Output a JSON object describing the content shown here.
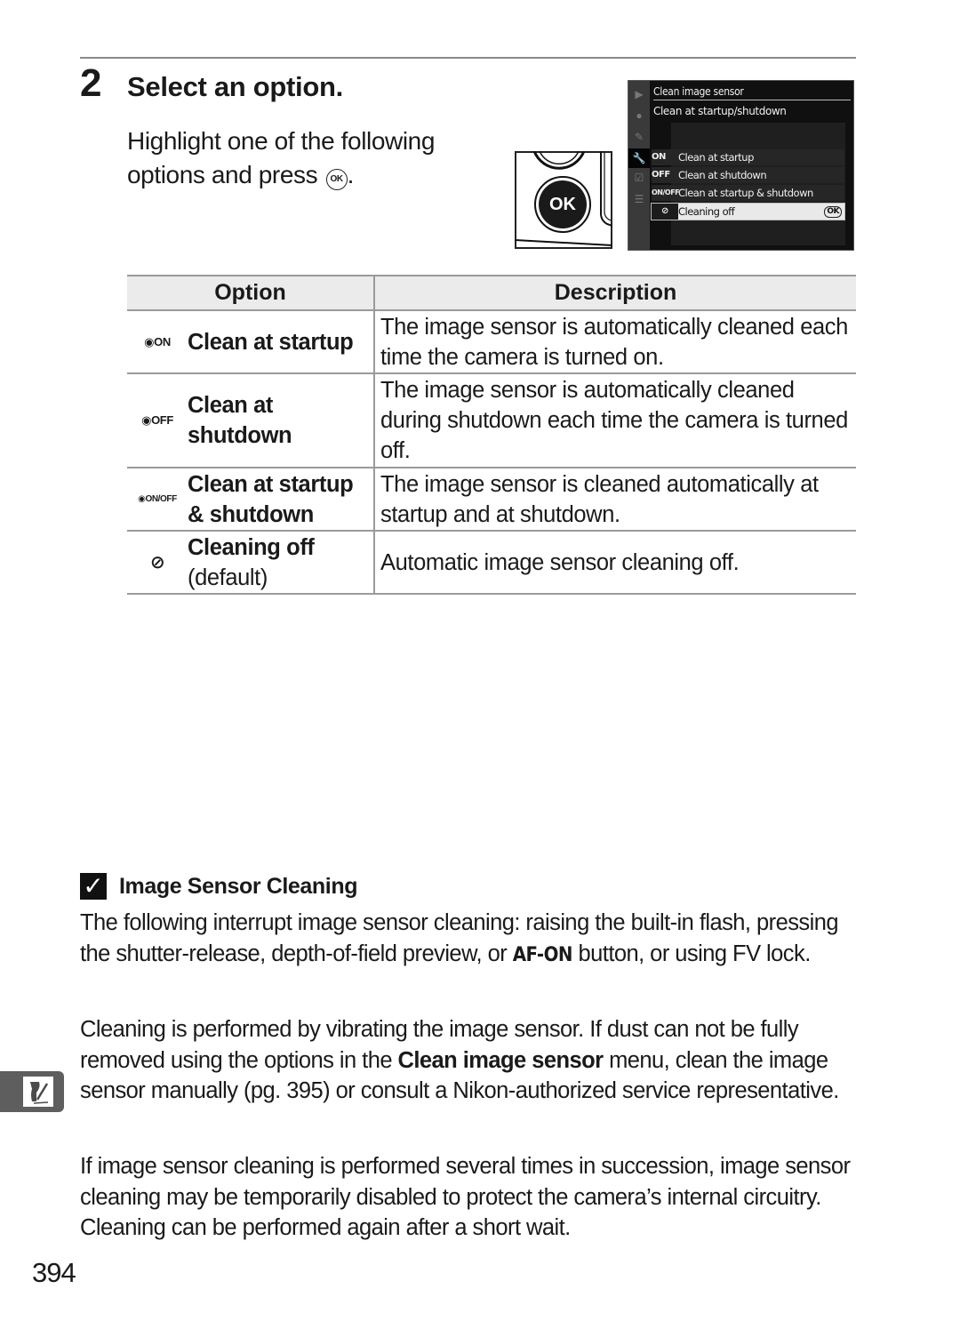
{
  "step": {
    "number": "2",
    "title": "Select an option.",
    "body_text": "Highlight one of the following options and press",
    "body_end": ".",
    "ok_glyph": "OK"
  },
  "illustration": {
    "button_label": "OK"
  },
  "camera_screen": {
    "menu_title": "Clean image sensor",
    "submenu_title": "Clean at startup/shutdown",
    "side_icons": [
      "playback-icon",
      "shooting-icon",
      "custom-settings-icon",
      "setup-wrench-icon",
      "retouch-icon",
      "my-menu-icon"
    ],
    "options": [
      {
        "icon": "ON",
        "label": "Clean at startup"
      },
      {
        "icon": "OFF",
        "label": "Clean at shutdown"
      },
      {
        "icon": "ON/OFF",
        "label": "Clean at startup & shutdown"
      },
      {
        "icon": "off",
        "label": "Cleaning off",
        "selected": true
      }
    ],
    "ok_badge": "OK"
  },
  "table": {
    "headers": [
      "Option",
      "Description"
    ],
    "rows": [
      {
        "icon_label": "ON",
        "icon_name": "clean-startup-icon",
        "option": "Clean at startup",
        "note": "",
        "description": "The image sensor is automatically cleaned each time the camera is turned on."
      },
      {
        "icon_label": "OFF",
        "icon_name": "clean-shutdown-icon",
        "option": "Clean at shutdown",
        "note": "",
        "description": "The image sensor is automatically cleaned during shutdown each time the camera is turned off."
      },
      {
        "icon_label": "ON/OFF",
        "icon_name": "clean-startup-shutdown-icon",
        "option": "Clean at startup & shutdown",
        "note": "",
        "description": "The image sensor is cleaned automatically at startup and at shutdown."
      },
      {
        "icon_label": "off",
        "icon_name": "cleaning-off-icon",
        "option": "Cleaning off",
        "note": "(default)",
        "description": "Automatic image sensor cleaning off."
      }
    ]
  },
  "note": {
    "check_glyph": "✓",
    "title": "Image Sensor Cleaning",
    "p1_a": "The following interrupt image sensor cleaning: raising the built-in flash, pressing the shutter-release, depth-of-field preview, or ",
    "p1_button": "AF-ON",
    "p1_b": " button, or using FV lock.",
    "p2_a": "Cleaning is performed by vibrating the image sensor.  If dust can not be fully removed using the options in the ",
    "p2_bold": "Clean image sensor",
    "p2_b": " menu, clean the image sensor manually (pg. 395) or consult a Nikon-authorized service representative.",
    "p3": "If image sensor cleaning is performed several times in succession, image sensor cleaning may be temporarily disabled to protect the camera’s internal circuitry.  Cleaning can be performed again after a short wait."
  },
  "page_number": "394"
}
